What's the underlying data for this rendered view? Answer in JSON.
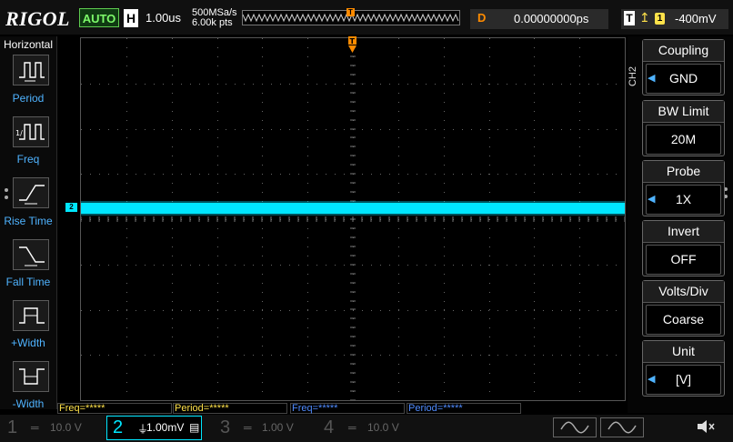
{
  "top": {
    "logo": "RIGOL",
    "auto_label": "AUTO",
    "h_label": "H",
    "timebase": "1.00us",
    "sample_rate": "500MSa/s",
    "mem_depth": "6.00k pts",
    "delay_label": "D",
    "delay_value": "0.00000000ps",
    "trigger_label": "T",
    "trigger_source": "1",
    "trigger_level": "-400mV",
    "trigger_top_marker": "T"
  },
  "left_menu": {
    "title": "Horizontal",
    "items": [
      {
        "label": "Period",
        "icon": "period-icon"
      },
      {
        "label": "Freq",
        "icon": "frequency-icon"
      },
      {
        "label": "Rise Time",
        "icon": "rise-time-icon"
      },
      {
        "label": "Fall Time",
        "icon": "fall-time-icon"
      },
      {
        "label": "+Width",
        "icon": "positive-width-icon"
      },
      {
        "label": "-Width",
        "icon": "negative-width-icon"
      }
    ]
  },
  "screen": {
    "ch2_marker": "2",
    "trigger_level_marker": "T",
    "trace_color": "#00e6ff"
  },
  "right_menu": {
    "channel_title": "CH2",
    "items": [
      {
        "title": "Coupling",
        "value": "GND",
        "arrow": true
      },
      {
        "title": "BW Limit",
        "value": "20M",
        "arrow": false
      },
      {
        "title": "Probe",
        "value": "1X",
        "arrow": true
      },
      {
        "title": "Invert",
        "value": "OFF",
        "arrow": false
      },
      {
        "title": "Volts/Div",
        "value": "Coarse",
        "arrow": false
      },
      {
        "title": "Unit",
        "value": "[V]",
        "arrow": true
      }
    ]
  },
  "measurements": [
    {
      "text": "Freq=*****",
      "color": "#ffe24a"
    },
    {
      "text": "Period=*****",
      "color": "#ffe24a"
    },
    {
      "text": "Freq=*****",
      "color": "#4f8bff"
    },
    {
      "text": "Period=*****",
      "color": "#4f8bff"
    }
  ],
  "channels": [
    {
      "num": "1",
      "scale": "10.0 V",
      "color": "#ffe24a",
      "active": false
    },
    {
      "num": "2",
      "scale": "1.00mV",
      "color": "#00e6ff",
      "active": true
    },
    {
      "num": "3",
      "scale": "1.00 V",
      "color": "#ff4fd8",
      "active": false
    },
    {
      "num": "4",
      "scale": "10.0 V",
      "color": "#4f8bff",
      "active": false
    }
  ],
  "bottom_right": {
    "gen1_icon": "sine-wave-icon",
    "gen2_icon": "sine-wave-icon",
    "speaker_icon": "speaker-muted-icon"
  }
}
